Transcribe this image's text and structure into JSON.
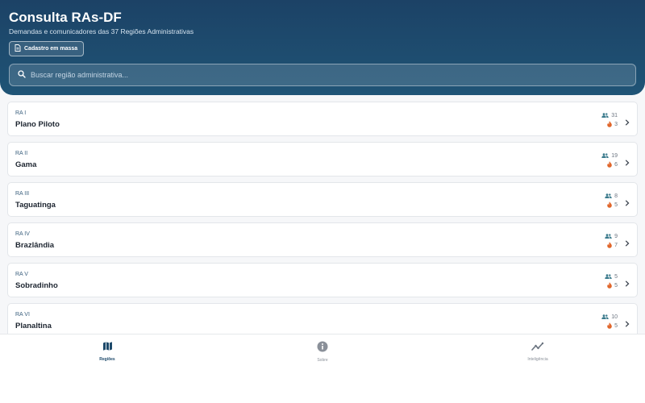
{
  "header": {
    "title": "Consulta RAs-DF",
    "subtitle": "Demandas e comunicadores das 37 Regiões Administrativas",
    "bulk_button_label": "Cadastro em massa",
    "search_placeholder": "Buscar região administrativa..."
  },
  "regions": [
    {
      "code": "RA I",
      "name": "Plano Piloto",
      "communicators": "31",
      "demands": "3"
    },
    {
      "code": "RA II",
      "name": "Gama",
      "communicators": "19",
      "demands": "6"
    },
    {
      "code": "RA III",
      "name": "Taguatinga",
      "communicators": "8",
      "demands": "5"
    },
    {
      "code": "RA IV",
      "name": "Brazlândia",
      "communicators": "9",
      "demands": "7"
    },
    {
      "code": "RA V",
      "name": "Sobradinho",
      "communicators": "5",
      "demands": "5"
    },
    {
      "code": "RA VI",
      "name": "Planaltina",
      "communicators": "10",
      "demands": "5"
    }
  ],
  "nav": {
    "items": [
      {
        "label": "Regiões",
        "icon": "map-icon",
        "active": true
      },
      {
        "label": "Sobre",
        "icon": "info-icon",
        "active": false
      },
      {
        "label": "Inteligência",
        "icon": "trend-icon",
        "active": false
      }
    ]
  },
  "colors": {
    "header": "#1c4266",
    "accent": "#1e4a6b",
    "communicators_icon": "#3a7a8c",
    "demands_icon": "#e0662b"
  }
}
